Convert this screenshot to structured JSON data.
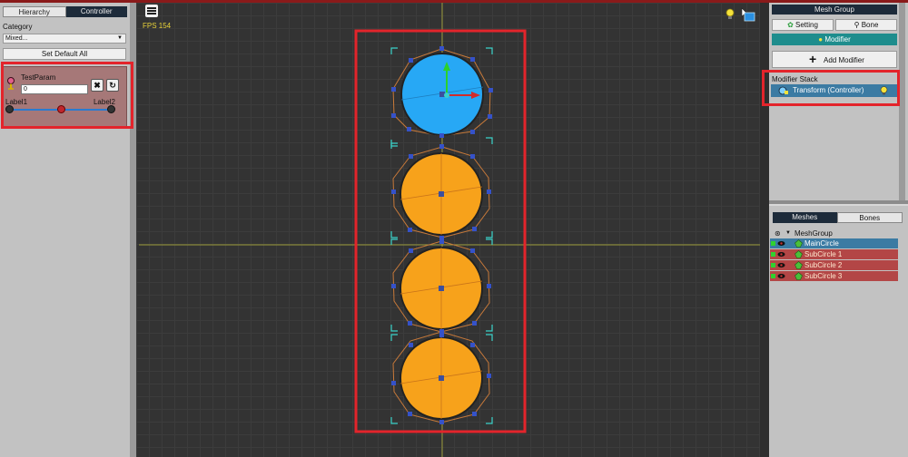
{
  "left_panel": {
    "tabs": [
      {
        "label": "Hierarchy",
        "active": false
      },
      {
        "label": "Controller",
        "active": true
      }
    ],
    "category_label": "Category",
    "category_value": "Mixed...",
    "set_default_label": "Set Default All",
    "param": {
      "name": "TestParam",
      "value": "0",
      "label_min": "Label1",
      "label_max": "Label2",
      "slider_value": 0.5
    }
  },
  "viewport": {
    "fps_text": "FPS 154",
    "icons": [
      "menu-icon",
      "lightbulb-icon",
      "cursor-icon",
      "image-icon"
    ]
  },
  "right_panel": {
    "header": "Mesh Group",
    "setting_label": "Setting",
    "bone_label": "Bone",
    "modifier_label": "Modifier",
    "add_modifier_label": "Add Modifier",
    "modifier_stack_label": "Modifier Stack",
    "modifier_stack_items": [
      {
        "label": "Transform (Controller)"
      }
    ],
    "mesh_tabs": [
      {
        "label": "Meshes",
        "active": true
      },
      {
        "label": "Bones",
        "active": false
      }
    ],
    "tree_root": "MeshGroup",
    "meshes": [
      {
        "label": "MainCircle",
        "state": "selected"
      },
      {
        "label": "SubCircle 1",
        "state": "sub"
      },
      {
        "label": "SubCircle 2",
        "state": "sub"
      },
      {
        "label": "SubCircle 3",
        "state": "sub"
      }
    ]
  },
  "colors": {
    "highlight_box": "#e3242b",
    "main_circle": "#2ea3f2",
    "sub_circle": "#f7a21b",
    "selected_row": "#3b7ba3",
    "sub_row": "#b34646",
    "accent_teal": "#1e8d8d"
  }
}
